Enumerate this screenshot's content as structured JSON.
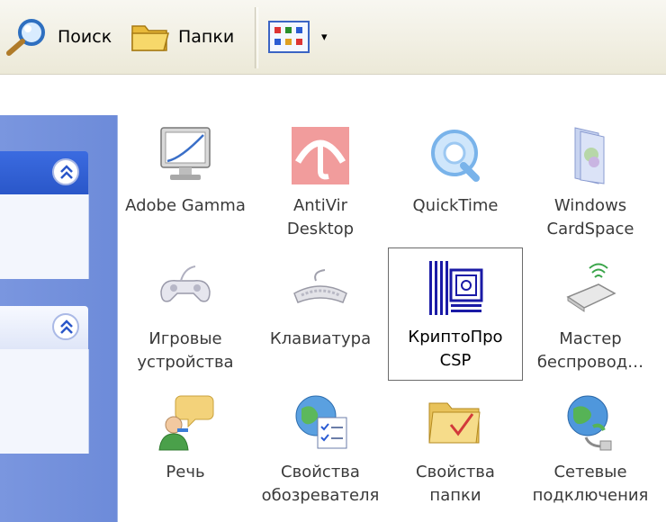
{
  "toolbar": {
    "search_label": "Поиск",
    "folders_label": "Папки",
    "views_arrow": "▾"
  },
  "icons": [
    {
      "label": "Adobe Gamma",
      "icon": "monitor-gamma-icon"
    },
    {
      "label": "AntiVir\nDesktop",
      "icon": "antivir-umbrella-icon"
    },
    {
      "label": "QuickTime",
      "icon": "quicktime-icon"
    },
    {
      "label": "Windows\nCardSpace",
      "icon": "cardspace-icon"
    },
    {
      "label": "Игровые\nустройства",
      "icon": "gamepad-icon"
    },
    {
      "label": "Клавиатура",
      "icon": "keyboard-icon"
    },
    {
      "label": "КриптоПро\nCSP",
      "icon": "cryptopro-icon",
      "selected": true
    },
    {
      "label": "Мастер\nбеспровод…",
      "icon": "wireless-usb-icon"
    },
    {
      "label": "Речь",
      "icon": "speech-icon"
    },
    {
      "label": "Свойства\nобозревателя",
      "icon": "internet-options-icon"
    },
    {
      "label": "Свойства\nпапки",
      "icon": "folder-options-icon"
    },
    {
      "label": "Сетевые\nподключения",
      "icon": "network-connections-icon"
    }
  ],
  "colors": {
    "task_pane": "#7a96df",
    "task_header": "#2a57c9",
    "selection_border": "#6b6b6b",
    "cryptopro_blue": "#1a1aa6",
    "antivir_red": "#e03a3a"
  }
}
